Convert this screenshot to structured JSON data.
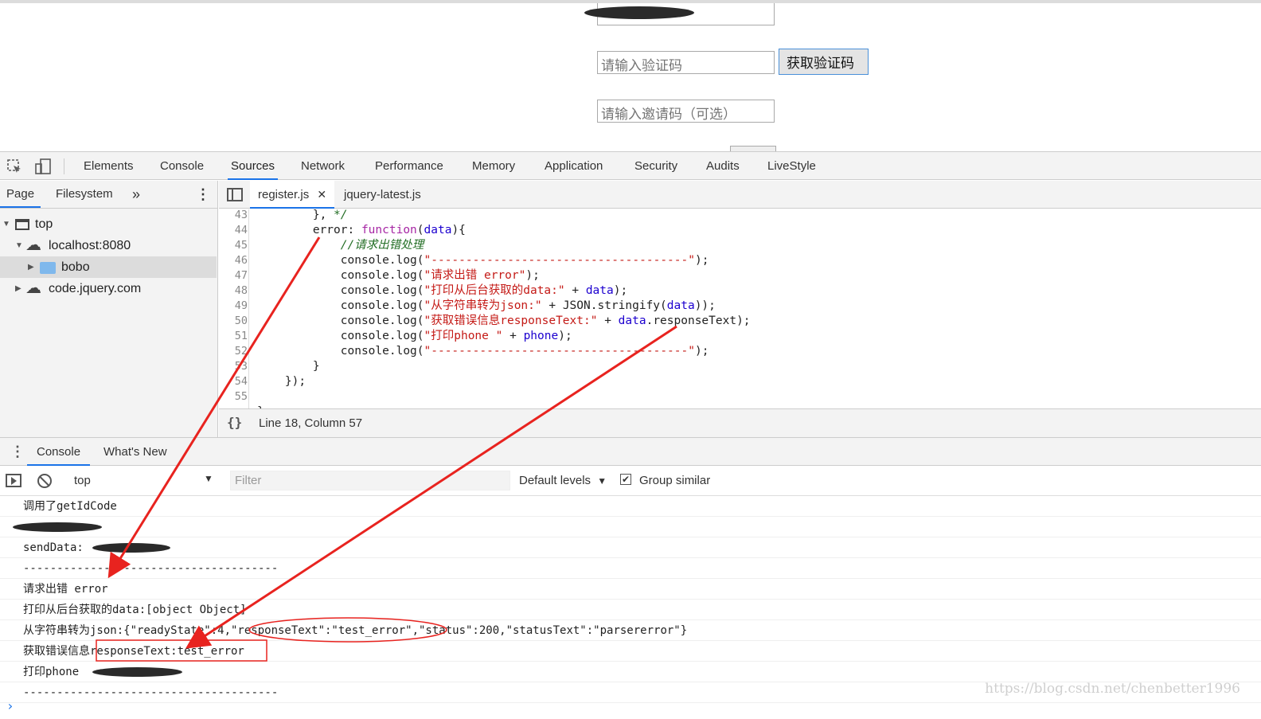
{
  "webpage": {
    "captcha_placeholder": "请输入验证码",
    "get_captcha_button": "获取验证码",
    "invite_placeholder": "请输入邀请码（可选）"
  },
  "devtools": {
    "tabs": [
      "Elements",
      "Console",
      "Sources",
      "Network",
      "Performance",
      "Memory",
      "Application",
      "Security",
      "Audits",
      "LiveStyle"
    ],
    "active_tab": "Sources"
  },
  "sidebar": {
    "tabs": [
      "Page",
      "Filesystem"
    ],
    "more_icon": "chevron-double-right-icon",
    "tree": [
      {
        "label": "top",
        "icon": "window-icon"
      },
      {
        "label": "localhost:8080",
        "icon": "cloud-icon"
      },
      {
        "label": "bobo",
        "icon": "folder-icon"
      },
      {
        "label": "code.jquery.com",
        "icon": "cloud-icon"
      }
    ]
  },
  "editor": {
    "files": [
      "register.js",
      "jquery-latest.js"
    ],
    "line_numbers": [
      "43",
      "44",
      "45",
      "46",
      "47",
      "48",
      "49",
      "50",
      "51",
      "52",
      "53",
      "54",
      "55"
    ],
    "status": "Line 18, Column 57"
  },
  "console": {
    "tabs": [
      "Console",
      "What's New"
    ],
    "context": "top",
    "filter_placeholder": "Filter",
    "levels": "Default levels",
    "group_similar": "Group similar",
    "lines": [
      "调用了getIdCode",
      "",
      "sendData: ",
      "--------------------------------------",
      "请求出错 error",
      "打印从后台获取的data:[object Object]",
      "从字符串转为json:{\"readyState\":4,\"responseText\":\"test_error\",\"status\":200,\"statusText\":\"parsererror\"}",
      "获取错误信息responseText:test_error",
      "打印phone ",
      "--------------------------------------"
    ]
  },
  "watermark": "https://blog.csdn.net/chenbetter1996",
  "colors": {
    "accent": "#1a73e8",
    "annotation": "#e8231f"
  }
}
